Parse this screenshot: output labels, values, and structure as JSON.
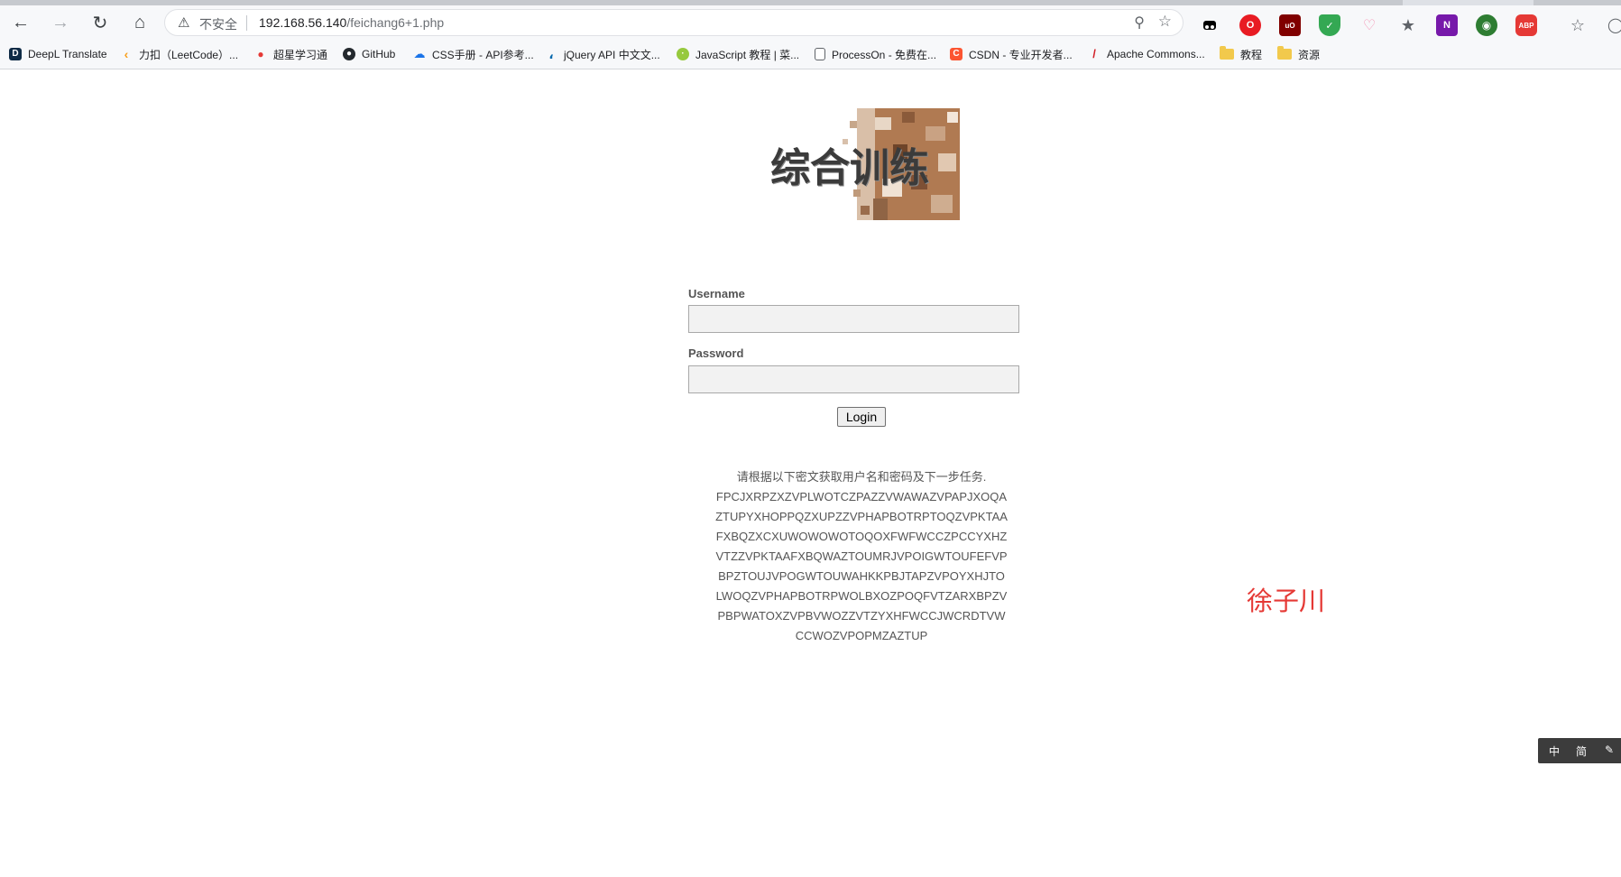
{
  "browser": {
    "address": {
      "security_label": "不安全",
      "url_host": "192.168.56.140",
      "url_path": "/feichang6+1.php"
    },
    "bookmarks": [
      {
        "label": "DeepL Translate",
        "icon": "deepl-icon"
      },
      {
        "label": "力扣（LeetCode）...",
        "icon": "leetcode-icon"
      },
      {
        "label": "超星学习通",
        "icon": "chaoxing-icon"
      },
      {
        "label": "GitHub",
        "icon": "github-icon"
      },
      {
        "label": "CSS手册 - API参考...",
        "icon": "cloud-icon"
      },
      {
        "label": "jQuery API 中文文...",
        "icon": "jquery-icon"
      },
      {
        "label": "JavaScript 教程 | 菜...",
        "icon": "runoob-icon"
      },
      {
        "label": "ProcessOn - 免费在...",
        "icon": "page-icon"
      },
      {
        "label": "CSDN - 专业开发者...",
        "icon": "csdn-icon"
      },
      {
        "label": "Apache Commons...",
        "icon": "apache-feather-icon"
      },
      {
        "label": "教程",
        "icon": "folder-icon"
      },
      {
        "label": "资源",
        "icon": "folder-icon"
      }
    ],
    "extensions": [
      {
        "name": "tampermonkey-icon",
        "color": "#000000",
        "glyph": "●●"
      },
      {
        "name": "opera-icon",
        "color": "#e81b23",
        "glyph": "O"
      },
      {
        "name": "ublock-icon",
        "color": "#800000",
        "glyph": "uO"
      },
      {
        "name": "shield-check-icon",
        "color": "#34a853",
        "glyph": "✓"
      },
      {
        "name": "cat-icon",
        "color": "#f8c0c8",
        "glyph": "◡"
      },
      {
        "name": "star-icon",
        "color": "#5f6368",
        "glyph": "★"
      },
      {
        "name": "onenote-icon",
        "color": "#7719aa",
        "glyph": "N"
      },
      {
        "name": "globe-icon",
        "color": "#2e7d32",
        "glyph": "◉"
      },
      {
        "name": "adblock-plus-icon",
        "color": "#e53935",
        "glyph": "ABP"
      }
    ]
  },
  "page": {
    "logo_text": "综合训练",
    "username_label": "Username",
    "password_label": "Password",
    "username_value": "",
    "password_value": "",
    "login_label": "Login",
    "instruction": "请根据以下密文获取用户名和密码及下一步任务.",
    "cipher_lines": [
      "FPCJXRPZXZVPLWOTCZPAZZVWAWAZVPAPJXOQA",
      "ZTUPYXHOPPQZXUPZZVPHAPBOTRPTOQZVPKTAA",
      "FXBQZXCXUWOWOWOTOQOXFWFWCCZPCCYXHZ",
      "VTZZVPKTAAFXBQWAZTOUMRJVPOIGWTOUFEFVP",
      "BPZTOUJVPOGWTOUWAHKKPBJTAPZVPOYXHJTO",
      "LWOQZVPHAPBOTRPWOLBXOZPOQFVTZARXBPZV",
      "PBPWATOXZVPBVWOZZVTZYXHFWCCJWCRDTVW",
      "CCWOZVPOPMZAZTUP"
    ],
    "author_name": "徐子川"
  },
  "ime": {
    "mode_label": "中",
    "script_label": "简",
    "tool_label": "✎"
  }
}
